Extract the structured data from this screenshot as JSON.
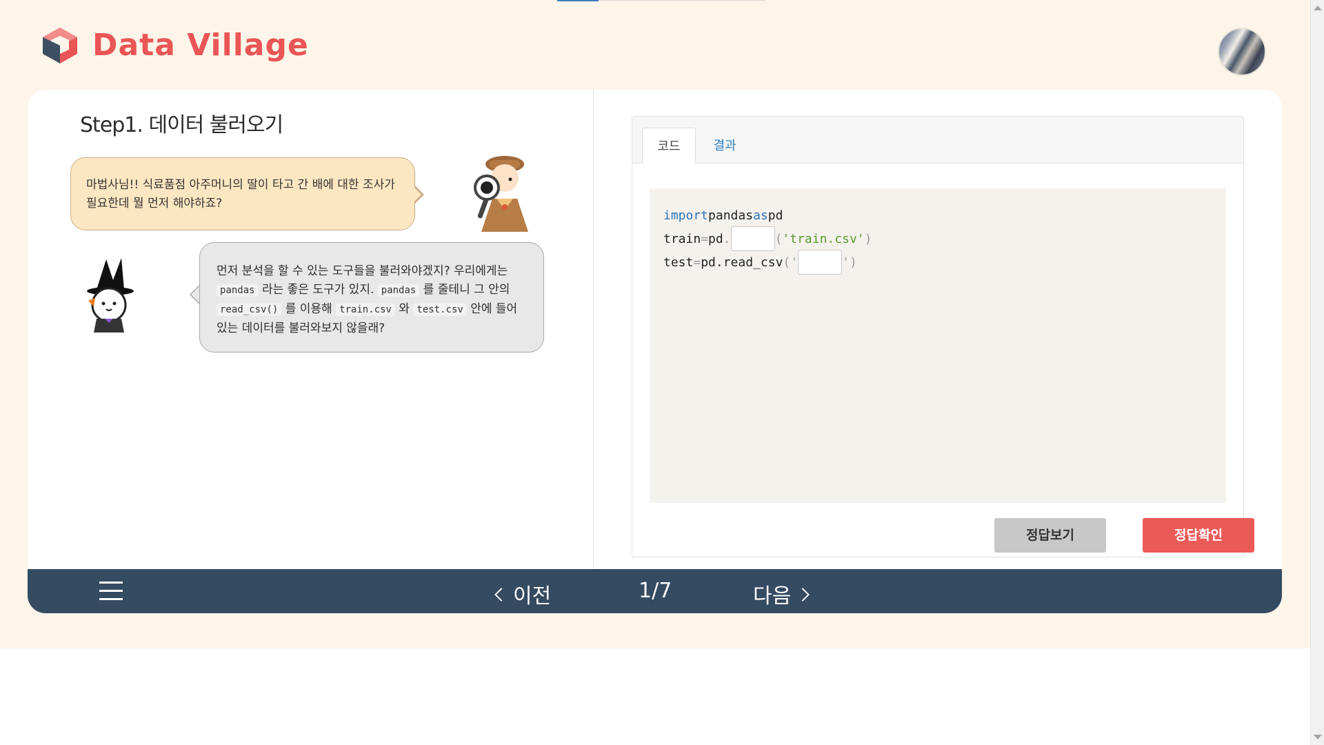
{
  "header": {
    "logo_text": "Data Village"
  },
  "colors": {
    "brand_red": "#ea5555",
    "check_button": "#ec5a58",
    "footer": "#344b61",
    "background": "#fdf5e9"
  },
  "lesson": {
    "step_title": "Step1. 데이터 불러오기",
    "detective_message": "마법사님!! 식료품점 아주머니의 딸이 타고 간 배에 대한 조사가 필요한데 뭘 먼저 해야하죠?",
    "wizard_message": {
      "part1": "먼저 분석을 할 수 있는 도구들을 불러와야겠지? 우리에게는",
      "chip1": "pandas",
      "part2": "라는 좋은 도구가 있지.",
      "chip2": "pandas",
      "part3": "를 줄테니 그 안의",
      "chip3": "read_csv()",
      "part4": "를 이용해",
      "chip4": "train.csv",
      "part5": "와",
      "chip5": "test.csv",
      "part6": "안에 들어있는 데이터를 불러와보지 않을래?"
    }
  },
  "code_panel": {
    "tabs": [
      {
        "label": "코드",
        "active": true
      },
      {
        "label": "결과",
        "active": false
      }
    ],
    "line1": {
      "kw1": "import",
      "mod": "pandas",
      "kw2": "as",
      "alias": "pd"
    },
    "line2": {
      "var": "train",
      "op": "=",
      "obj": "pd",
      "dot": ".",
      "arg_open": "(",
      "arg": "'train.csv'",
      "arg_close": ")"
    },
    "line3": {
      "var": "test",
      "op": "=",
      "call": "pd.read_csv",
      "open": "('",
      "close": "')"
    },
    "show_answer_label": "정답보기",
    "check_answer_label": "정답확인"
  },
  "footer": {
    "prev_label": "이전",
    "page_indicator": "1/7",
    "next_label": "다음"
  },
  "icons": [
    "logo-icon",
    "menu-icon",
    "chevron-left-icon",
    "chevron-right-icon"
  ]
}
